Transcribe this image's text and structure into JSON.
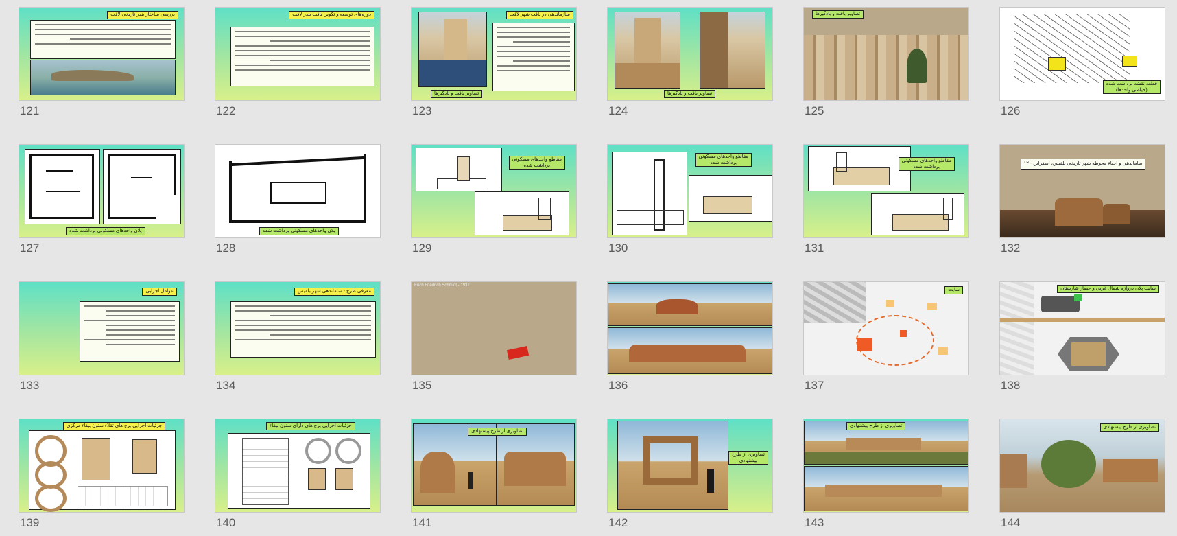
{
  "slides": [
    {
      "num": "121",
      "title": "بررسی ساختار بندر تاریخی لافت"
    },
    {
      "num": "122",
      "title": "دوره‌های توسعه و تکوین بافت بندر لافت"
    },
    {
      "num": "123",
      "title": "سازماندهی در بافت شهر لافت",
      "caption": "تصاویر بافت و بادگیرها"
    },
    {
      "num": "124",
      "caption": "تصاویر بافت و بادگیرها"
    },
    {
      "num": "125",
      "title": "تصاویر بافت و بادگیرها"
    },
    {
      "num": "126",
      "caption_line1": "قطعه نقشه برداشت شده",
      "caption_line2": "(حیاطی واحدها)"
    },
    {
      "num": "127",
      "caption": "پلان واحدهای مسکونی برداشت شده"
    },
    {
      "num": "128",
      "caption": "پلان واحدهای مسکونی برداشت شده"
    },
    {
      "num": "129",
      "caption_line1": "مقاطع واحدهای مسکونی",
      "caption_line2": "برداشت شده"
    },
    {
      "num": "130",
      "caption_line1": "مقاطع واحدهای مسکونی",
      "caption_line2": "برداشت شده"
    },
    {
      "num": "131",
      "caption_line1": "مقاطع واحدهای مسکونی",
      "caption_line2": "برداشت شده"
    },
    {
      "num": "132",
      "title": "۱۲ - ساماندهی و احیاء محوطه شهر تاریخی بلقیس، اسفراین"
    },
    {
      "num": "133",
      "title": "عوامل اجرایی"
    },
    {
      "num": "134",
      "title": "معرفی طرح - ساماندهی شهر بلقیس"
    },
    {
      "num": "135",
      "photo_label": "Erich Friedrich Schmidt - 1937"
    },
    {
      "num": "136"
    },
    {
      "num": "137",
      "title": "سایت"
    },
    {
      "num": "138",
      "title": "سایت پلان دروازه شمال غربی و حصار شارستان"
    },
    {
      "num": "139",
      "title": "جزئیات اجرایی برج های تقلاء ستون بیقاء مرکزی"
    },
    {
      "num": "140",
      "title": "جزئیات اجرایی برج های دارای ستون بیقاء"
    },
    {
      "num": "141",
      "title": "تصاویری از طرح پیشنهادی"
    },
    {
      "num": "142",
      "caption_line1": "تصاویری از طرح",
      "caption_line2": "پیشنهادی"
    },
    {
      "num": "143",
      "title": "تصاویری از طرح پیشنهادی"
    },
    {
      "num": "144",
      "title": "تصاویری از طرح پیشنهادی"
    }
  ],
  "colors": {
    "background": "#e6e6e6",
    "gradient_top": "#5fe0c6",
    "gradient_bottom": "#d8f08a",
    "title_yellow": "#f5f04a",
    "title_green": "#b5e868",
    "number_text": "#5a5a5a"
  }
}
